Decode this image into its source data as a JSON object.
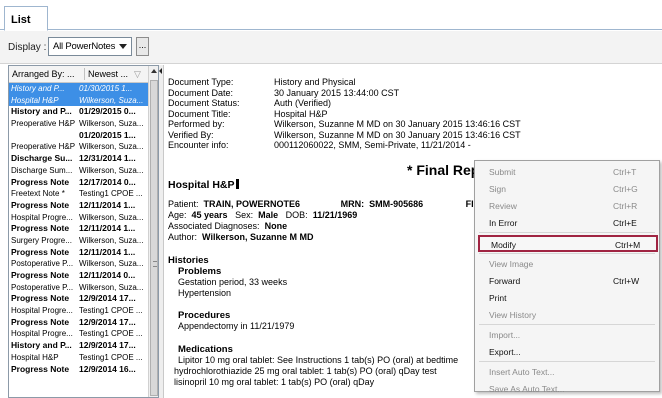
{
  "tab": {
    "label": "List"
  },
  "display": {
    "label": "Display :",
    "value": "All PowerNotes",
    "ellipsis": "..."
  },
  "list": {
    "header": {
      "col1": "Arranged By: ...",
      "col2": "Newest ..."
    },
    "rows": [
      {
        "a": "History and P...",
        "b": "01/30/2015 1...",
        "style": "sel"
      },
      {
        "a": "Hospital H&P",
        "b": "Wilkerson, Suza...",
        "style": "sel"
      },
      {
        "a": "History and P...",
        "b": "01/29/2015 0...",
        "style": "bold"
      },
      {
        "a": "Preoperative H&P",
        "b": "Wilkerson, Suza...",
        "style": ""
      },
      {
        "a": "",
        "b": "01/20/2015 1...",
        "style": "bold"
      },
      {
        "a": "Preoperative H&P",
        "b": "Wilkerson, Suza...",
        "style": ""
      },
      {
        "a": "Discharge Su...",
        "b": "12/31/2014 1...",
        "style": "bold"
      },
      {
        "a": "Discharge Sum...",
        "b": "Wilkerson, Suza...",
        "style": ""
      },
      {
        "a": "Progress Note",
        "b": "12/17/2014 0...",
        "style": "bold"
      },
      {
        "a": "Freetext Note *",
        "b": "Testing1 CPOE ...",
        "style": ""
      },
      {
        "a": "Progress Note",
        "b": "12/11/2014 1...",
        "style": "bold"
      },
      {
        "a": "Hospital Progre...",
        "b": "Wilkerson, Suza...",
        "style": ""
      },
      {
        "a": "Progress Note",
        "b": "12/11/2014 1...",
        "style": "bold"
      },
      {
        "a": "Surgery Progre...",
        "b": "Wilkerson, Suza...",
        "style": ""
      },
      {
        "a": "Progress Note",
        "b": "12/11/2014 1...",
        "style": "bold"
      },
      {
        "a": "Postoperative P...",
        "b": "Wilkerson, Suza...",
        "style": ""
      },
      {
        "a": "Progress Note",
        "b": "12/11/2014 0...",
        "style": "bold"
      },
      {
        "a": "Postoperative P...",
        "b": "Wilkerson, Suza...",
        "style": ""
      },
      {
        "a": "Progress Note",
        "b": "12/9/2014 17...",
        "style": "bold"
      },
      {
        "a": "Hospital Progre...",
        "b": "Testing1 CPOE ...",
        "style": ""
      },
      {
        "a": "Progress Note",
        "b": "12/9/2014 17...",
        "style": "bold"
      },
      {
        "a": "Hospital Progre...",
        "b": "Testing1 CPOE ...",
        "style": ""
      },
      {
        "a": "History and P...",
        "b": "12/9/2014 17...",
        "style": "bold"
      },
      {
        "a": "Hospital H&P",
        "b": "Testing1 CPOE ...",
        "style": ""
      },
      {
        "a": "Progress Note",
        "b": "12/9/2014 16...",
        "style": "bold"
      }
    ]
  },
  "document": {
    "meta": [
      {
        "k": "Document Type:",
        "v": "History and Physical"
      },
      {
        "k": "Document Date:",
        "v": "30 January 2015 13:44:00 CST"
      },
      {
        "k": "Document Status:",
        "v": "Auth (Verified)"
      },
      {
        "k": "Document Title:",
        "v": "Hospital H&P"
      },
      {
        "k": "Performed by:",
        "v": "Wilkerson, Suzanne M MD on 30 January 2015 13:46:16 CST"
      },
      {
        "k": "Verified By:",
        "v": "Wilkerson, Suzanne M MD on 30 January 2015 13:46:16 CST"
      },
      {
        "k": "Encounter info:",
        "v": "000112060022, SMM, Semi-Private, 11/21/2014 -"
      }
    ],
    "final": "* Final Rep",
    "hp_title": "Hospital H&P",
    "patient_label": "Patient:",
    "patient_value": "TRAIN, POWERNOTE6",
    "mrn_label": "MRN:",
    "mrn_value": "SMM-905686",
    "fin_label": "FIN:",
    "age_label": "Age:",
    "age_value": "45 years",
    "sex_label": "Sex:",
    "sex_value": "Male",
    "dob_label": "DOB:",
    "dob_value": "11/21/1969",
    "assoc_label": "Associated Diagnoses:",
    "assoc_value": "None",
    "author_label": "Author:",
    "author_value": "Wilkerson, Suzanne M MD",
    "histories": "Histories",
    "problems": "Problems",
    "problem1": "Gestation period, 33 weeks",
    "problem2": "Hypertension",
    "procedures": "Procedures",
    "procedure1": "Appendectomy in 11/21/1979",
    "medications": "Medications",
    "med1": "Lipitor 10 mg oral tablet: See Instructions 1 tab(s) PO (oral) at bedtime",
    "med2": "hydrochlorothiazide 25 mg oral tablet: 1 tab(s) PO (oral) qDay test",
    "med3": "lisinopril 10 mg oral tablet: 1 tab(s) PO (oral) qDay"
  },
  "menu": {
    "items": [
      {
        "label": "Submit",
        "shortcut": "Ctrl+T",
        "enabled": false
      },
      {
        "label": "Sign",
        "shortcut": "Ctrl+G",
        "enabled": false
      },
      {
        "label": "Review",
        "shortcut": "Ctrl+R",
        "enabled": false
      },
      {
        "label": "In Error",
        "shortcut": "Ctrl+E",
        "enabled": true
      },
      {
        "label": "Modify",
        "shortcut": "Ctrl+M",
        "enabled": true,
        "highlighted": true
      },
      {
        "label": "View Image",
        "shortcut": "",
        "enabled": false
      },
      {
        "label": "Forward",
        "shortcut": "Ctrl+W",
        "enabled": true
      },
      {
        "label": "Print",
        "shortcut": "",
        "enabled": true
      },
      {
        "label": "View History",
        "shortcut": "",
        "enabled": false
      },
      {
        "label": "Import...",
        "shortcut": "",
        "enabled": false
      },
      {
        "label": "Export...",
        "shortcut": "",
        "enabled": true
      },
      {
        "label": "Insert Auto Text...",
        "shortcut": "",
        "enabled": false
      },
      {
        "label": "Save As Auto Text...",
        "shortcut": "",
        "enabled": false
      }
    ],
    "highlight_color": "#a02442"
  }
}
